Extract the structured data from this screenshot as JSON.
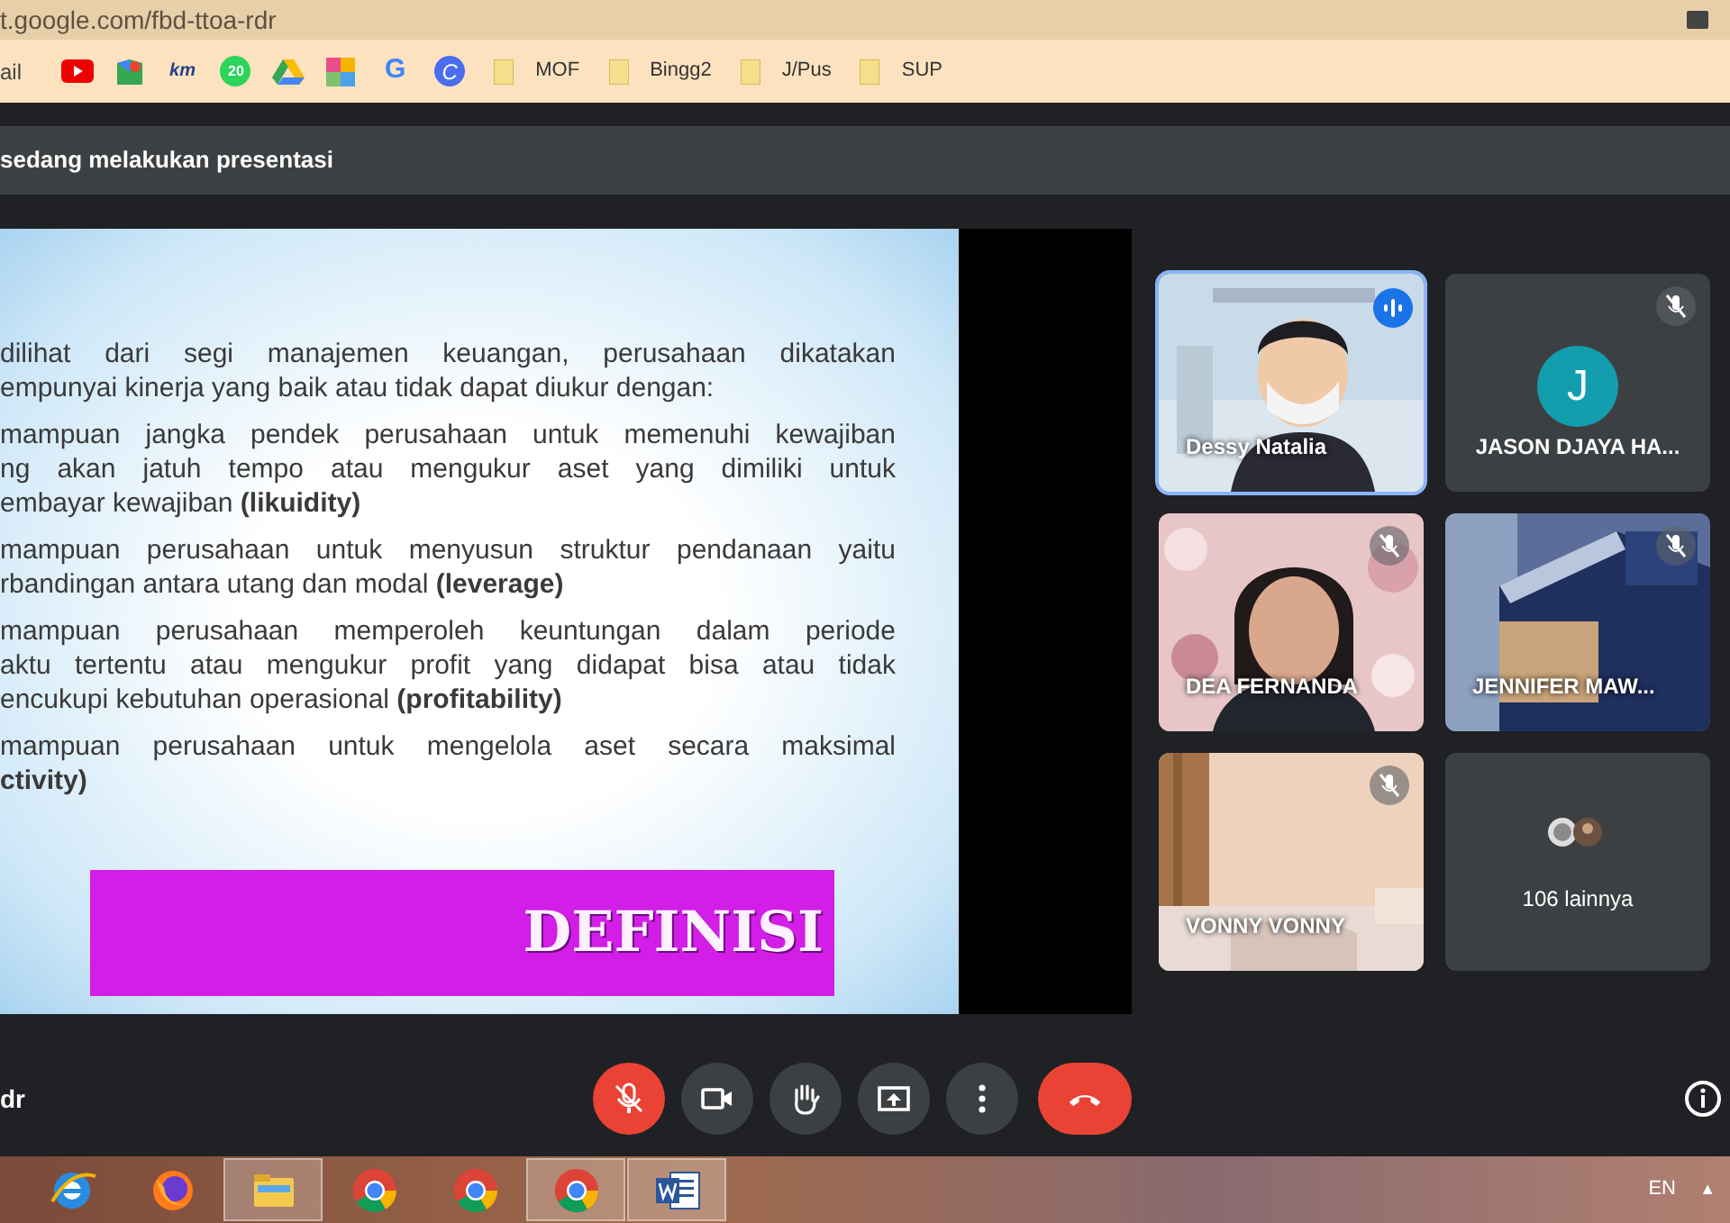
{
  "browser": {
    "url": "t.google.com/fbd-ttoa-rdr",
    "bookmarks": [
      {
        "kind": "text",
        "label": "ail"
      },
      {
        "kind": "youtube"
      },
      {
        "kind": "maps"
      },
      {
        "kind": "glyph",
        "glyph": "km"
      },
      {
        "kind": "badge",
        "glyph": "20"
      },
      {
        "kind": "drive"
      },
      {
        "kind": "grid"
      },
      {
        "kind": "google",
        "glyph": "G"
      },
      {
        "kind": "circle",
        "glyph": "C"
      },
      {
        "kind": "folder",
        "label": "MOF"
      },
      {
        "kind": "folder",
        "label": "Bingg2"
      },
      {
        "kind": "folder",
        "label": "J/Pus"
      },
      {
        "kind": "folder",
        "label": "SUP"
      }
    ]
  },
  "presentation_banner": "sedang melakukan presentasi",
  "slide": {
    "paragraphs": [
      {
        "lines": [
          "dilihat dari segi manajemen keuangan, perusahaan dikatakan",
          "empunyai kinerja yang baik atau tidak dapat diukur dengan:"
        ]
      },
      {
        "lines": [
          "mampuan jangka pendek perusahaan untuk memenuhi kewajiban",
          "ng akan jatuh tempo atau mengukur aset yang dimiliki untuk",
          "embayar kewajiban **(likuidity)**"
        ]
      },
      {
        "lines": [
          "mampuan perusahaan untuk menyusun struktur  pendanaan yaitu",
          "rbandingan antara utang dan modal **(leverage)**"
        ]
      },
      {
        "lines": [
          "mampuan perusahaan memperoleh keuntungan dalam periode",
          "aktu tertentu atau mengukur profit yang didapat bisa atau tidak",
          "encukupi kebutuhan operasional **(profitability)**"
        ]
      },
      {
        "lines": [
          "mampuan perusahaan untuk mengelola aset secara maksimal",
          "**ctivity)**"
        ]
      }
    ],
    "banner": "DEFINISI"
  },
  "participants": [
    {
      "kind": "video",
      "name": "Dessy Natalia",
      "speaking": true,
      "muted": false
    },
    {
      "kind": "avatar",
      "name": "JASON DJAYA HA...",
      "initial": "J",
      "speaking": false,
      "muted": true
    },
    {
      "kind": "video",
      "name": "DEA FERNANDA",
      "speaking": false,
      "muted": true
    },
    {
      "kind": "video",
      "name": "JENNIFER MAW...",
      "speaking": false,
      "muted": true
    },
    {
      "kind": "video",
      "name": "VONNY VONNY",
      "speaking": false,
      "muted": true
    },
    {
      "kind": "more",
      "name": "106 lainnya",
      "speaking": false,
      "muted": false
    }
  ],
  "controls": {
    "meeting_code": "dr",
    "buttons": [
      {
        "kind": "mic",
        "on": false
      },
      {
        "kind": "camera",
        "on": true
      },
      {
        "kind": "hand"
      },
      {
        "kind": "present"
      },
      {
        "kind": "more"
      },
      {
        "kind": "end"
      }
    ]
  },
  "taskbar": {
    "apps": [
      {
        "kind": "ie",
        "active": false
      },
      {
        "kind": "firefox",
        "active": false
      },
      {
        "kind": "explorer",
        "active": true
      },
      {
        "kind": "chrome",
        "active": false
      },
      {
        "kind": "chrome",
        "active": false
      },
      {
        "kind": "chrome",
        "active": true
      },
      {
        "kind": "word",
        "active": true
      }
    ],
    "language": "EN",
    "tray_arrow": "▲"
  }
}
